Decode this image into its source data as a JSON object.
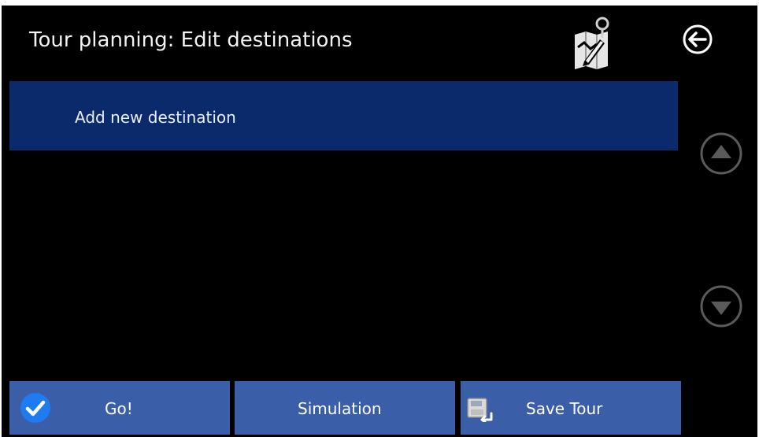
{
  "header": {
    "title": "Tour planning: Edit destinations",
    "map_edit_icon": "map-edit-icon",
    "back_icon": "arrow-left-circle-icon"
  },
  "list": {
    "items": [
      {
        "label": "Add new destination",
        "selected": true
      }
    ]
  },
  "scroll": {
    "up_icon": "triangle-up-circle-icon",
    "down_icon": "triangle-down-circle-icon"
  },
  "actions": {
    "go_label": "Go!",
    "go_icon": "checkmark-circle-icon",
    "simulation_label": "Simulation",
    "save_tour_label": "Save Tour",
    "save_tour_icon": "save-tour-icon"
  },
  "colors": {
    "background": "#000000",
    "selected_row": "#0b2a6b",
    "button": "#3a5ea7",
    "check_accent": "#1e7bf0",
    "text": "#ffffff"
  }
}
